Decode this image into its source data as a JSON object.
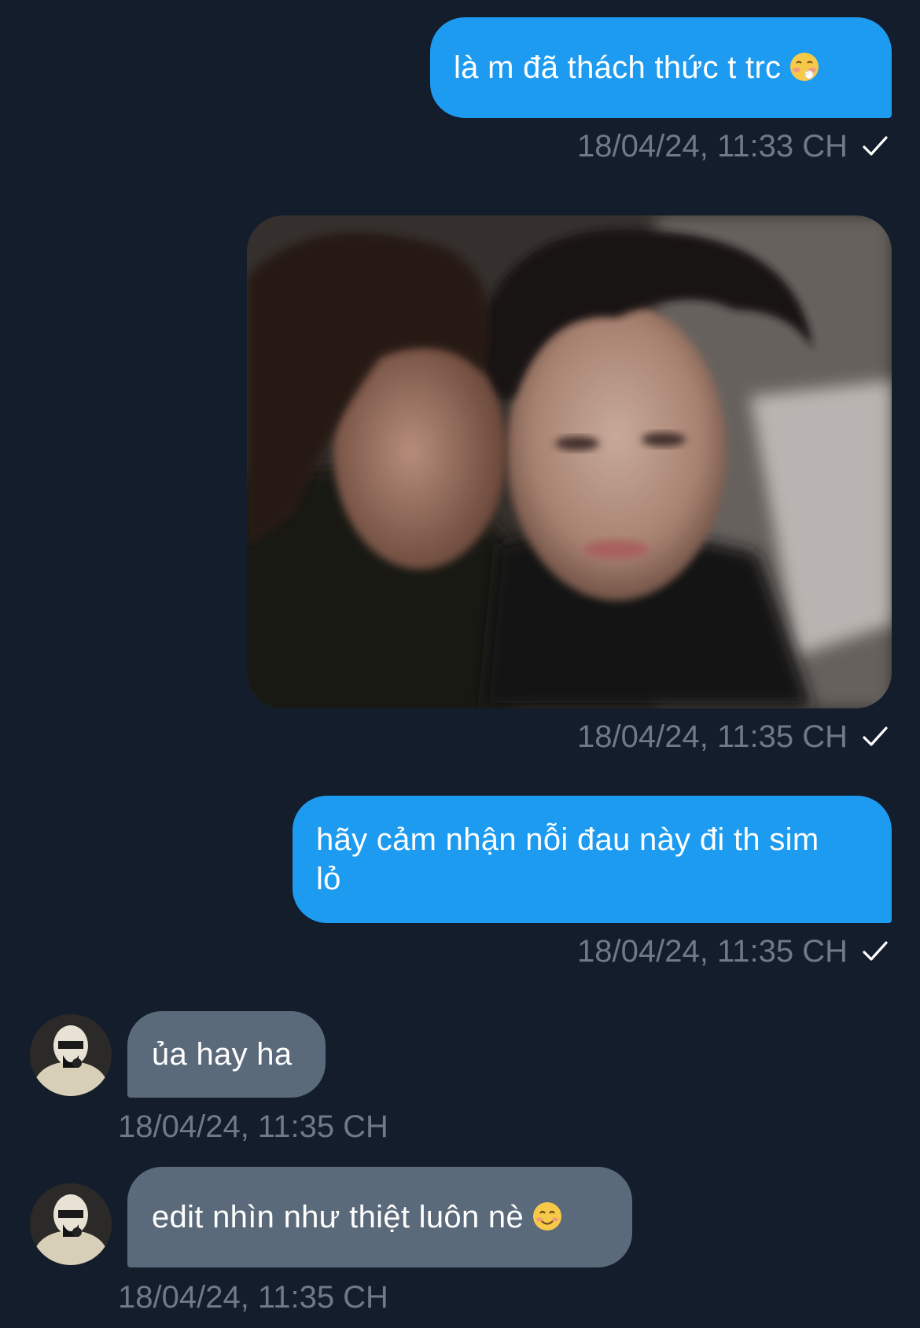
{
  "messages": [
    {
      "direction": "outgoing",
      "type": "text",
      "text": "là m đã thách thức t trc",
      "emoji": "flushed-face-emoji",
      "timestamp": "18/04/24, 11:33 CH",
      "status": "sent-check"
    },
    {
      "direction": "outgoing",
      "type": "image",
      "image_alt": "blurred photo of two young men, one kissing the other's cheek",
      "timestamp": "18/04/24, 11:35 CH",
      "status": "sent-check"
    },
    {
      "direction": "outgoing",
      "type": "text",
      "text_line1": "hãy cảm nhận nỗi đau này đi th sim",
      "text_line2": "lỏ",
      "timestamp": "18/04/24, 11:35 CH",
      "status": "sent-check"
    },
    {
      "direction": "incoming",
      "type": "text",
      "text": "ủa hay ha",
      "timestamp": "18/04/24, 11:35 CH",
      "avatar": "contact-avatar"
    },
    {
      "direction": "incoming",
      "type": "text",
      "text": "edit nhìn như thiệt luôn nè",
      "emoji": "smiling-face-emoji",
      "timestamp": "18/04/24, 11:35 CH",
      "avatar": "contact-avatar"
    }
  ],
  "colors": {
    "background": "#141d2b",
    "outgoing_bubble": "#1d9bf0",
    "incoming_bubble": "#5b6a7a",
    "timestamp": "#6e7a89"
  }
}
